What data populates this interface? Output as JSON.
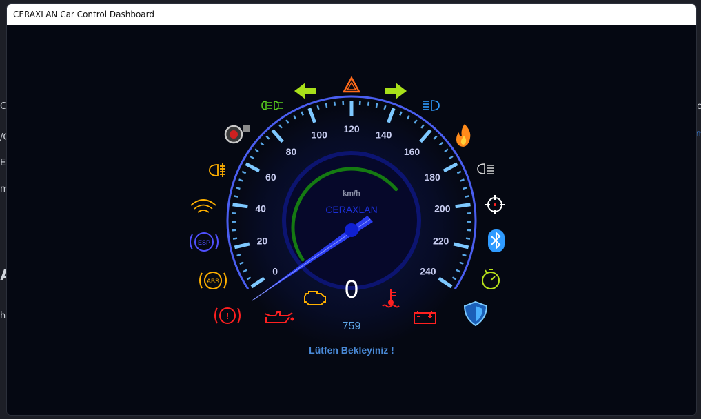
{
  "window": {
    "title": "CERAXLAN Car Control Dashboard"
  },
  "gauge": {
    "unit": "km/h",
    "brand": "CERAXLAN",
    "speed": 0,
    "rpm": "759",
    "status_text": "Lütfen Bekleyiniz !",
    "scale_labels": [
      "0",
      "20",
      "40",
      "60",
      "80",
      "100",
      "120",
      "140",
      "160",
      "180",
      "200",
      "220",
      "240"
    ],
    "max_speed": 240,
    "needle_value": 0,
    "ring_fraction": 0.7
  },
  "indicators": [
    {
      "name": "left-turn-signal-icon",
      "color": "#a8e01a"
    },
    {
      "name": "hazard-warning-icon",
      "color": "#ff6a1a"
    },
    {
      "name": "right-turn-signal-icon",
      "color": "#a8e01a"
    },
    {
      "name": "low-beam-icon",
      "color": "#2f9bff"
    },
    {
      "name": "high-beam-icon",
      "color": "#5ad11e"
    },
    {
      "name": "turbo-icon",
      "color": "#c9c9c9"
    },
    {
      "name": "fire-icon",
      "color": "#ff8a1a"
    },
    {
      "name": "fog-light-front-icon",
      "color": "#ffb000"
    },
    {
      "name": "fog-light-rear-icon",
      "color": "#d8d8d8"
    },
    {
      "name": "wifi-icon",
      "color": "#ffb000"
    },
    {
      "name": "target-icon",
      "color": "#ffffff"
    },
    {
      "name": "esp-icon",
      "color": "#5050ff"
    },
    {
      "name": "bluetooth-icon",
      "color": "#2f9bff"
    },
    {
      "name": "abs-icon",
      "color": "#ffb000"
    },
    {
      "name": "stopwatch-icon",
      "color": "#b7e01a"
    },
    {
      "name": "brake-warning-icon",
      "color": "#ff2020"
    },
    {
      "name": "oil-pressure-icon",
      "color": "#ff2020"
    },
    {
      "name": "engine-check-icon",
      "color": "#ffb000"
    },
    {
      "name": "coolant-temp-icon",
      "color": "#ff2020"
    },
    {
      "name": "battery-icon",
      "color": "#ff2020"
    },
    {
      "name": "shield-icon",
      "color": "#2fa8ff"
    }
  ],
  "background_fragments": [
    "C",
    "/C",
    "ED",
    "m",
    "h",
    "to",
    "m",
    "A"
  ]
}
